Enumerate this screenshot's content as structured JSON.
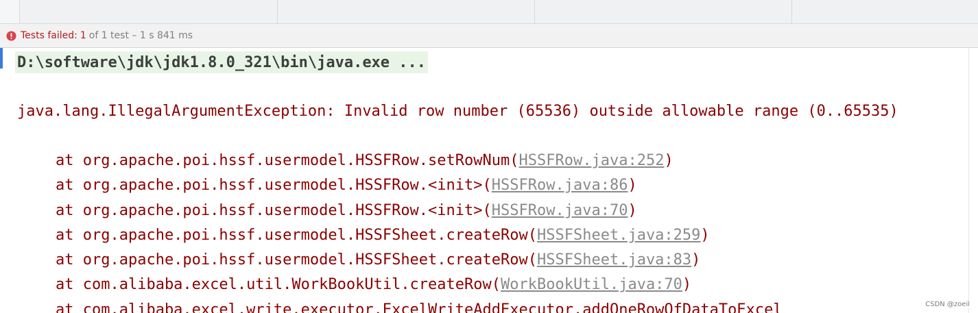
{
  "status": {
    "icon": "error-circle-icon",
    "failed_label": "Tests failed:",
    "failed_count": "1",
    "summary": "of 1 test – 1 s 841 ms"
  },
  "console": {
    "command": "D:\\software\\jdk\\jdk1.8.0_321\\bin\\java.exe ...",
    "exception": "java.lang.IllegalArgumentException: Invalid row number (65536) outside allowable range (0..65535)",
    "stack": [
      {
        "prefix": "at org.apache.poi.hssf.usermodel.HSSFRow.setRowNum(",
        "link": "HSSFRow.java:252",
        "suffix": ")"
      },
      {
        "prefix": "at org.apache.poi.hssf.usermodel.HSSFRow.<init>(",
        "link": "HSSFRow.java:86",
        "suffix": ")"
      },
      {
        "prefix": "at org.apache.poi.hssf.usermodel.HSSFRow.<init>(",
        "link": "HSSFRow.java:70",
        "suffix": ")"
      },
      {
        "prefix": "at org.apache.poi.hssf.usermodel.HSSFSheet.createRow(",
        "link": "HSSFSheet.java:259",
        "suffix": ")"
      },
      {
        "prefix": "at org.apache.poi.hssf.usermodel.HSSFSheet.createRow(",
        "link": "HSSFSheet.java:83",
        "suffix": ")"
      },
      {
        "prefix": "at com.alibaba.excel.util.WorkBookUtil.createRow(",
        "link": "WorkBookUtil.java:70",
        "suffix": ")"
      },
      {
        "prefix": "at com.alibaba.excel.write.executor.ExcelWriteAddExecutor.addOneRowOfDataToExcel",
        "link": "",
        "suffix": ""
      }
    ]
  },
  "watermark": "CSDN @zoeil",
  "colors": {
    "error_text": "#8b0000",
    "link_text": "#8a8a8a",
    "command_bg": "#e8f5e6",
    "status_failed": "#b31b1b"
  }
}
